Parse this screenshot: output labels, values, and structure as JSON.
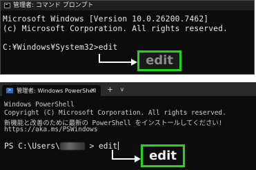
{
  "cmd_window": {
    "title": "管理者: コマンド プロンプト",
    "lines": [
      "Microsoft Windows [Version 10.0.26200.7462]",
      "(c) Microsoft Corporation. All rights reserved.",
      "C:¥Windows¥System32>edit"
    ],
    "callout_text": "edit"
  },
  "ps_window": {
    "tab_title": "管理者: Windows PowerShell",
    "tab_close": "×",
    "new_tab": "+",
    "dropdown": "∨",
    "lines": [
      "Windows PowerShell",
      "Copyright (C) Microsoft Corporation. All rights reserved.",
      "新機能と改善のために最新の PowerShell をインストールしてください!",
      "https://aka.ms/PSWindows"
    ],
    "prompt_prefix": "PS C:\\Users\\",
    "prompt_suffix": " > edit",
    "callout_text": "edit"
  },
  "colors": {
    "highlight_green": "#25d321",
    "arrow": "#ffffff"
  },
  "icons": [
    "console-icon",
    "powershell-icon",
    "close-icon",
    "plus-icon",
    "chevron-down-icon",
    "arrow-icon"
  ]
}
